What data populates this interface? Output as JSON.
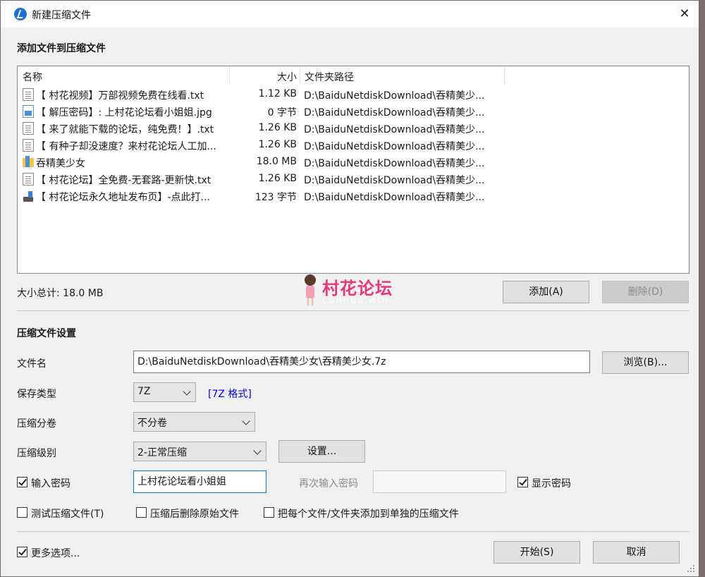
{
  "window": {
    "title": "新建压缩文件",
    "close_glyph": "✕"
  },
  "add_section": {
    "title": "添加文件到压缩文件",
    "columns": {
      "name": "名称",
      "size": "大小",
      "path": "文件夹路径"
    },
    "files": [
      {
        "icon": "text-file-icon",
        "name": "【 村花视频】万部视频免费在线看.txt",
        "size": "1.12 KB",
        "path": "D:\\BaiduNetdiskDownload\\吞精美少..."
      },
      {
        "icon": "image-file-icon",
        "name": "【 解压密码】: 上村花论坛看小姐姐.jpg",
        "size": "0 字节",
        "path": "D:\\BaiduNetdiskDownload\\吞精美少..."
      },
      {
        "icon": "text-file-icon",
        "name": "【 来了就能下载的论坛，纯免费！】.txt",
        "size": "1.26 KB",
        "path": "D:\\BaiduNetdiskDownload\\吞精美少..."
      },
      {
        "icon": "text-file-icon",
        "name": "【 有种子却没速度？来村花论坛人工加...",
        "size": "1.26 KB",
        "path": "D:\\BaiduNetdiskDownload\\吞精美少..."
      },
      {
        "icon": "folder-icon",
        "name": "吞精美少女",
        "size": "18.0 MB",
        "path": "D:\\BaiduNetdiskDownload\\吞精美少..."
      },
      {
        "icon": "text-file-icon",
        "name": "【 村花论坛】全免费-无套路-更新快.txt",
        "size": "1.26 KB",
        "path": "D:\\BaiduNetdiskDownload\\吞精美少..."
      },
      {
        "icon": "shortcut-file-icon",
        "name": "【 村花论坛永久地址发布页】-点此打...",
        "size": "123 字节",
        "path": "D:\\BaiduNetdiskDownload\\吞精美少..."
      }
    ],
    "total_size": "大小总计: 18.0 MB",
    "add_button": "添加(A)",
    "delete_button": "删除(D)"
  },
  "watermark": {
    "title": "村花论坛",
    "subtitle": "cunhua.win"
  },
  "settings": {
    "title": "压缩文件设置",
    "filename_label": "文件名",
    "filename_value": "D:\\BaiduNetdiskDownload\\吞精美少女\\吞精美少女.7z",
    "browse_button": "浏览(B)...",
    "save_type_label": "保存类型",
    "save_type_value": "7Z",
    "format_link": "[7Z 格式]",
    "split_label": "压缩分卷",
    "split_value": "不分卷",
    "level_label": "压缩级别",
    "level_value": "2-正常压缩",
    "settings_button": "设置...",
    "password_checkbox": "输入密码",
    "password_value": "上村花论坛看小姐姐",
    "password_confirm_label": "再次输入密码",
    "password_confirm_value": "",
    "show_password": "显示密码",
    "test_archive": "测试压缩文件(T)",
    "delete_after": "压缩后删除原始文件",
    "separate_archives": "把每个文件/文件夹添加到单独的压缩文件"
  },
  "footer": {
    "more_options": "更多选项...",
    "start_button": "开始(S)",
    "cancel_button": "取消"
  }
}
